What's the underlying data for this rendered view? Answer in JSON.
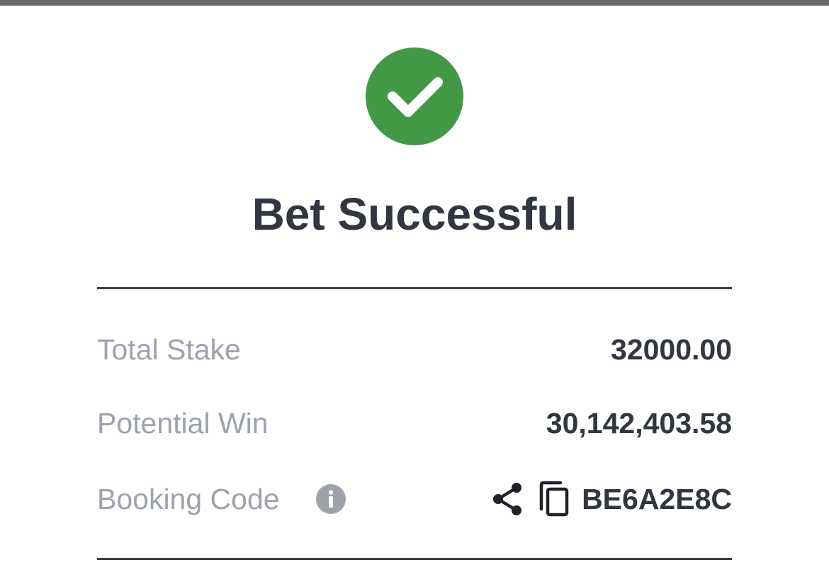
{
  "title": "Bet Successful",
  "status_icon": "check-circle-icon",
  "colors": {
    "success": "#439845",
    "text_primary": "#313640",
    "text_secondary": "#9ea2ab",
    "top_bar": "#6b6b6b"
  },
  "summary": {
    "total_stake": {
      "label": "Total Stake",
      "value": "32000.00"
    },
    "potential_win": {
      "label": "Potential Win",
      "value": "30,142,403.58"
    },
    "booking_code": {
      "label": "Booking Code",
      "value": "BE6A2E8C",
      "icons": [
        "info-icon",
        "share-icon",
        "copy-icon"
      ]
    }
  }
}
